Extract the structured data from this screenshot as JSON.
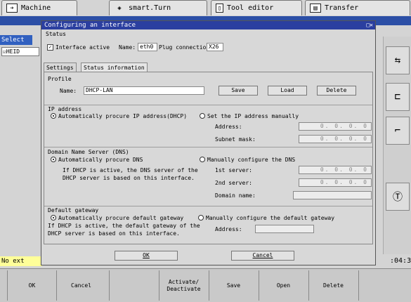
{
  "top_tabs": [
    {
      "label": "Machine",
      "icon": "arrow-right-icon"
    },
    {
      "label": "smart.Turn",
      "icon": "diamond-arrow-icon"
    },
    {
      "label": "Tool editor",
      "icon": "document-icon"
    },
    {
      "label": "Transfer",
      "icon": "save-icon"
    }
  ],
  "background": {
    "select_label": "Select",
    "heid_label": "HEID",
    "status_bar_text": "No ext",
    "clock": ":04:34"
  },
  "dialog": {
    "title": "Configuring an interface",
    "close_glyph": "□✕",
    "status": {
      "group_label": "Status",
      "interface_active_label": "Interface active",
      "interface_active_checked": true,
      "name_label": "Name:",
      "name_value": "eth0",
      "plug_label": "Plug connection:",
      "plug_value": "X26"
    },
    "tabs": [
      "Settings",
      "Status information"
    ],
    "profile": {
      "group_label": "Profile",
      "name_label": "Name:",
      "name_value": "DHCP-LAN",
      "save": "Save",
      "load": "Load",
      "delete": "Delete"
    },
    "ip": {
      "group_label": "IP address",
      "auto_label": "Automatically procure IP address(DHCP)",
      "manual_label": "Set the IP address manually",
      "address_label": "Address:",
      "address_value": "0. 0. 0. 0",
      "subnet_label": "Subnet mask:",
      "subnet_value": "0. 0. 0. 0"
    },
    "dns": {
      "group_label": "Domain Name Server (DNS)",
      "auto_label": "Automatically procure DNS",
      "manual_label": "Manually configure the DNS",
      "info_line1": "If DHCP is active, the DNS server of the",
      "info_line2": "DHCP server is based on this interface.",
      "server1_label": "1st server:",
      "server1_value": "0. 0. 0. 0",
      "server2_label": "2nd server:",
      "server2_value": "0. 0. 0. 0",
      "domain_label": "Domain name:",
      "domain_value": ""
    },
    "gateway": {
      "group_label": "Default gateway",
      "auto_label": "Automatically procure default gateway",
      "manual_label": "Manually configure the default gateway",
      "info_line1": "If DHCP is active, the default gateway of the",
      "info_line2": "DHCP server is based on this interface.",
      "address_label": "Address:",
      "address_value": ""
    },
    "ok": "OK",
    "cancel": "Cancel"
  },
  "softkeys": [
    "OK",
    "Cancel",
    "",
    "Activate/\nDeactivate",
    "Save",
    "Open",
    "Delete",
    ""
  ]
}
